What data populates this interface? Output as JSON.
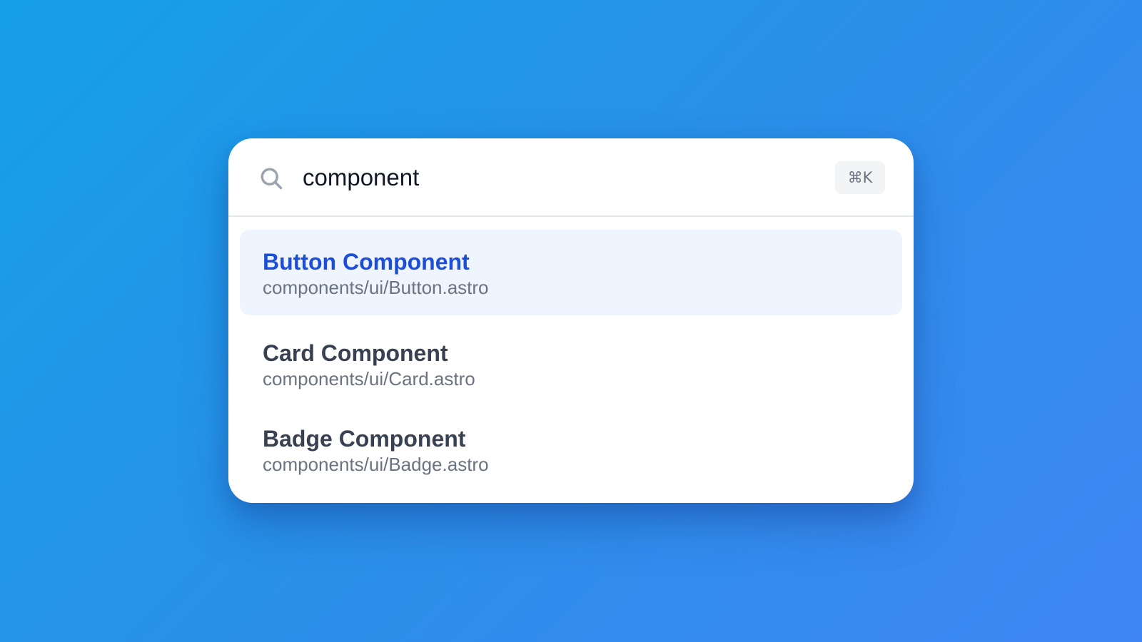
{
  "search": {
    "query": "component",
    "shortcut": "⌘K"
  },
  "results": [
    {
      "title": "Button Component",
      "path": "components/ui/Button.astro",
      "active": true
    },
    {
      "title": "Card Component",
      "path": "components/ui/Card.astro",
      "active": false
    },
    {
      "title": "Badge Component",
      "path": "components/ui/Badge.astro",
      "active": false
    }
  ],
  "colors": {
    "accent": "#1d4ed8",
    "active_bg": "#eef5fe",
    "background_start": "#15a0e8",
    "background_end": "#3f86f3"
  },
  "icons": {
    "search": "search-icon"
  }
}
